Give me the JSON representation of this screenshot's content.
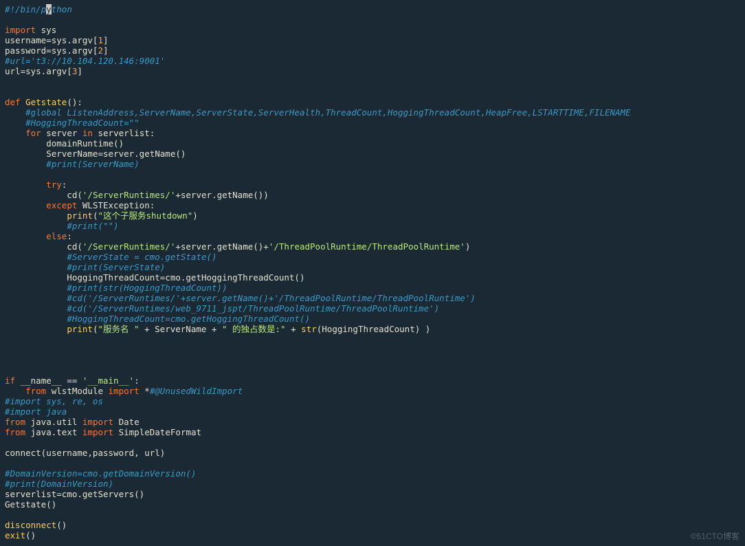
{
  "watermark": "©51CTO博客",
  "cursor": {
    "line": 0,
    "col": 8,
    "char": "y"
  },
  "chart_data": null,
  "code": {
    "lines": [
      [
        {
          "cls": "c-cmt",
          "txt": "#!/bin/p"
        },
        {
          "cls": "cursor",
          "txt": "y"
        },
        {
          "cls": "c-cmt",
          "txt": "thon"
        }
      ],
      [
        {
          "cls": "c-id",
          "txt": ""
        }
      ],
      [
        {
          "cls": "c-kw",
          "txt": "import"
        },
        {
          "cls": "c-id",
          "txt": " sys"
        }
      ],
      [
        {
          "cls": "c-id",
          "txt": "username=sys.argv["
        },
        {
          "cls": "c-num",
          "txt": "1"
        },
        {
          "cls": "c-id",
          "txt": "]"
        }
      ],
      [
        {
          "cls": "c-id",
          "txt": "password=sys.argv["
        },
        {
          "cls": "c-num",
          "txt": "2"
        },
        {
          "cls": "c-id",
          "txt": "]"
        }
      ],
      [
        {
          "cls": "c-cmt",
          "txt": "#url='t3://10.104.120.146:9001'"
        }
      ],
      [
        {
          "cls": "c-id",
          "txt": "url=sys.argv["
        },
        {
          "cls": "c-num",
          "txt": "3"
        },
        {
          "cls": "c-id",
          "txt": "]"
        }
      ],
      [
        {
          "cls": "c-id",
          "txt": ""
        }
      ],
      [
        {
          "cls": "c-id",
          "txt": ""
        }
      ],
      [
        {
          "cls": "c-kw",
          "txt": "def"
        },
        {
          "cls": "c-id",
          "txt": " "
        },
        {
          "cls": "c-fn",
          "txt": "Getstate"
        },
        {
          "cls": "c-id",
          "txt": "():"
        }
      ],
      [
        {
          "cls": "c-id",
          "txt": "    "
        },
        {
          "cls": "c-cmt",
          "txt": "#global ListenAddress,ServerName,ServerState,ServerHealth,ThreadCount,HoggingThreadCount,HeapFree,LSTARTTIME,FILENAME"
        }
      ],
      [
        {
          "cls": "c-id",
          "txt": "    "
        },
        {
          "cls": "c-cmt",
          "txt": "#HoggingThreadCount=\"\""
        }
      ],
      [
        {
          "cls": "c-id",
          "txt": "    "
        },
        {
          "cls": "c-kw",
          "txt": "for"
        },
        {
          "cls": "c-id",
          "txt": " server "
        },
        {
          "cls": "c-kw",
          "txt": "in"
        },
        {
          "cls": "c-id",
          "txt": " serverlist:"
        }
      ],
      [
        {
          "cls": "c-id",
          "txt": "        domainRuntime()"
        }
      ],
      [
        {
          "cls": "c-id",
          "txt": "        ServerName=server.getName()"
        }
      ],
      [
        {
          "cls": "c-id",
          "txt": "        "
        },
        {
          "cls": "c-cmt",
          "txt": "#print(ServerName)"
        }
      ],
      [
        {
          "cls": "c-id",
          "txt": ""
        }
      ],
      [
        {
          "cls": "c-id",
          "txt": "        "
        },
        {
          "cls": "c-kw",
          "txt": "try"
        },
        {
          "cls": "c-id",
          "txt": ":"
        }
      ],
      [
        {
          "cls": "c-id",
          "txt": "            cd("
        },
        {
          "cls": "c-str",
          "txt": "'/ServerRuntimes/'"
        },
        {
          "cls": "c-id",
          "txt": "+server.getName())"
        }
      ],
      [
        {
          "cls": "c-id",
          "txt": "        "
        },
        {
          "cls": "c-kw",
          "txt": "except"
        },
        {
          "cls": "c-id",
          "txt": " WLSTException:"
        }
      ],
      [
        {
          "cls": "c-id",
          "txt": "            "
        },
        {
          "cls": "c-fn",
          "txt": "print"
        },
        {
          "cls": "c-id",
          "txt": "("
        },
        {
          "cls": "c-str",
          "txt": "\"这个子服务shutdown\""
        },
        {
          "cls": "c-id",
          "txt": ")"
        }
      ],
      [
        {
          "cls": "c-id",
          "txt": "            "
        },
        {
          "cls": "c-cmt",
          "txt": "#print(\"\")"
        }
      ],
      [
        {
          "cls": "c-id",
          "txt": "        "
        },
        {
          "cls": "c-kw",
          "txt": "else"
        },
        {
          "cls": "c-id",
          "txt": ":"
        }
      ],
      [
        {
          "cls": "c-id",
          "txt": "            cd("
        },
        {
          "cls": "c-str",
          "txt": "'/ServerRuntimes/'"
        },
        {
          "cls": "c-id",
          "txt": "+server.getName()+"
        },
        {
          "cls": "c-str",
          "txt": "'/ThreadPoolRuntime/ThreadPoolRuntime'"
        },
        {
          "cls": "c-id",
          "txt": ")"
        }
      ],
      [
        {
          "cls": "c-id",
          "txt": "            "
        },
        {
          "cls": "c-cmt",
          "txt": "#ServerState = cmo.getState()"
        }
      ],
      [
        {
          "cls": "c-id",
          "txt": "            "
        },
        {
          "cls": "c-cmt",
          "txt": "#print(ServerState)"
        }
      ],
      [
        {
          "cls": "c-id",
          "txt": "            HoggingThreadCount=cmo.getHoggingThreadCount()"
        }
      ],
      [
        {
          "cls": "c-id",
          "txt": "            "
        },
        {
          "cls": "c-cmt",
          "txt": "#print(str(HoggingThreadCount))"
        }
      ],
      [
        {
          "cls": "c-id",
          "txt": "            "
        },
        {
          "cls": "c-cmt",
          "txt": "#cd('/ServerRuntimes/'+server.getName()+'/ThreadPoolRuntime/ThreadPoolRuntime')"
        }
      ],
      [
        {
          "cls": "c-id",
          "txt": "            "
        },
        {
          "cls": "c-cmt",
          "txt": "#cd('/ServerRuntimes/web_9711_jspt/ThreadPoolRuntime/ThreadPoolRuntime')"
        }
      ],
      [
        {
          "cls": "c-id",
          "txt": "            "
        },
        {
          "cls": "c-cmt",
          "txt": "#HoggingThreadCount=cmo.getHoggingThreadCount()"
        }
      ],
      [
        {
          "cls": "c-id",
          "txt": "            "
        },
        {
          "cls": "c-fn",
          "txt": "print"
        },
        {
          "cls": "c-id",
          "txt": "("
        },
        {
          "cls": "c-str",
          "txt": "\"服务名 \""
        },
        {
          "cls": "c-id",
          "txt": " + ServerName + "
        },
        {
          "cls": "c-str",
          "txt": "\" 的独占数是:\""
        },
        {
          "cls": "c-id",
          "txt": " + "
        },
        {
          "cls": "c-fn",
          "txt": "str"
        },
        {
          "cls": "c-id",
          "txt": "(HoggingThreadCount) )"
        }
      ],
      [
        {
          "cls": "c-id",
          "txt": ""
        }
      ],
      [
        {
          "cls": "c-id",
          "txt": ""
        }
      ],
      [
        {
          "cls": "c-id",
          "txt": ""
        }
      ],
      [
        {
          "cls": "c-id",
          "txt": ""
        }
      ],
      [
        {
          "cls": "c-kw",
          "txt": "if"
        },
        {
          "cls": "c-id",
          "txt": " __name__ == "
        },
        {
          "cls": "c-str",
          "txt": "'__main__'"
        },
        {
          "cls": "c-id",
          "txt": ":"
        }
      ],
      [
        {
          "cls": "c-id",
          "txt": "    "
        },
        {
          "cls": "c-kw",
          "txt": "from"
        },
        {
          "cls": "c-id",
          "txt": " wlstModule "
        },
        {
          "cls": "c-kw",
          "txt": "import"
        },
        {
          "cls": "c-id",
          "txt": " *"
        },
        {
          "cls": "c-cmt",
          "txt": "#@UnusedWildImport"
        }
      ],
      [
        {
          "cls": "c-cmt",
          "txt": "#import sys, re, os"
        }
      ],
      [
        {
          "cls": "c-cmt",
          "txt": "#import java"
        }
      ],
      [
        {
          "cls": "c-kw",
          "txt": "from"
        },
        {
          "cls": "c-id",
          "txt": " java.util "
        },
        {
          "cls": "c-kw",
          "txt": "import"
        },
        {
          "cls": "c-id",
          "txt": " Date"
        }
      ],
      [
        {
          "cls": "c-kw",
          "txt": "from"
        },
        {
          "cls": "c-id",
          "txt": " java.text "
        },
        {
          "cls": "c-kw",
          "txt": "import"
        },
        {
          "cls": "c-id",
          "txt": " SimpleDateFormat"
        }
      ],
      [
        {
          "cls": "c-id",
          "txt": ""
        }
      ],
      [
        {
          "cls": "c-id",
          "txt": "connect(username,password, url)"
        }
      ],
      [
        {
          "cls": "c-id",
          "txt": ""
        }
      ],
      [
        {
          "cls": "c-cmt",
          "txt": "#DomainVersion=cmo.getDomainVersion()"
        }
      ],
      [
        {
          "cls": "c-cmt",
          "txt": "#print(DomainVersion)"
        }
      ],
      [
        {
          "cls": "c-id",
          "txt": "serverlist=cmo.getServers()"
        }
      ],
      [
        {
          "cls": "c-id",
          "txt": "Getstate()"
        }
      ],
      [
        {
          "cls": "c-id",
          "txt": ""
        }
      ],
      [
        {
          "cls": "c-fn",
          "txt": "disconnect"
        },
        {
          "cls": "c-id",
          "txt": "()"
        }
      ],
      [
        {
          "cls": "c-fn",
          "txt": "exit"
        },
        {
          "cls": "c-id",
          "txt": "()"
        }
      ]
    ]
  }
}
